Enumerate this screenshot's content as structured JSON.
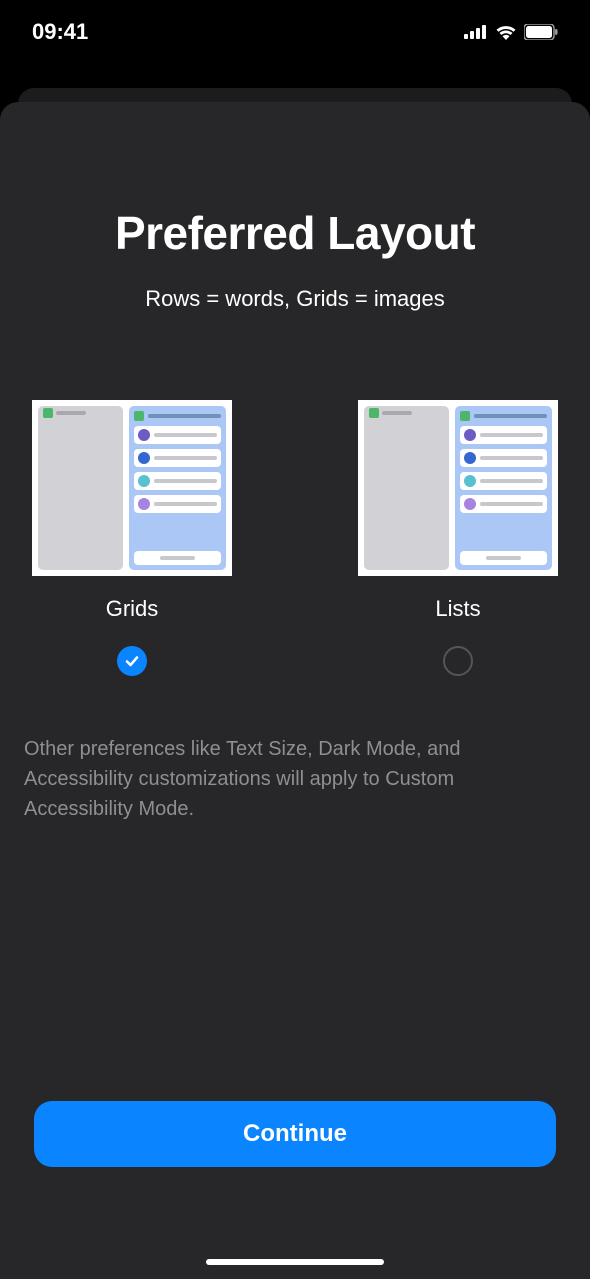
{
  "status": {
    "time": "09:41"
  },
  "header": {
    "title": "Preferred Layout",
    "subtitle": "Rows = words, Grids = images"
  },
  "options": {
    "grids": {
      "label": "Grids",
      "selected": true
    },
    "lists": {
      "label": "Lists",
      "selected": false
    }
  },
  "footnote": "Other preferences like Text Size, Dark Mode, and Accessibility customizations will apply to Custom Accessibility Mode.",
  "actions": {
    "continue": "Continue"
  }
}
